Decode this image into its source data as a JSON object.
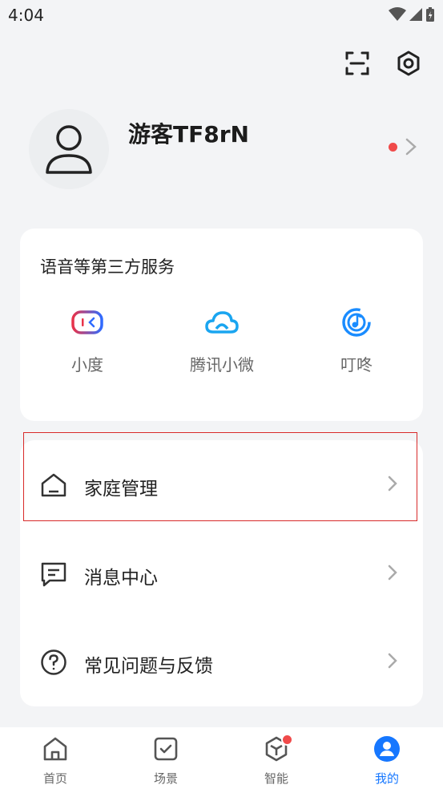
{
  "status_bar": {
    "time": "4:04"
  },
  "profile": {
    "username": "游客TF8rN"
  },
  "voice_services": {
    "title": "语音等第三方服务",
    "items": [
      {
        "label": "小度",
        "icon": "xiaodu-icon"
      },
      {
        "label": "腾讯小微",
        "icon": "tencent-xiaowei-icon"
      },
      {
        "label": "叮咚",
        "icon": "dingdong-icon"
      }
    ]
  },
  "menu": {
    "items": [
      {
        "label": "家庭管理",
        "icon": "home-icon"
      },
      {
        "label": "消息中心",
        "icon": "message-icon"
      },
      {
        "label": "常见问题与反馈",
        "icon": "help-icon"
      }
    ]
  },
  "tabbar": {
    "tabs": [
      {
        "label": "首页",
        "icon": "home-tab-icon"
      },
      {
        "label": "场景",
        "icon": "scene-icon"
      },
      {
        "label": "智能",
        "icon": "smart-icon"
      },
      {
        "label": "我的",
        "icon": "profile-tab-icon"
      }
    ],
    "active_index": 3
  },
  "colors": {
    "accent": "#1677ff",
    "alert": "#f04a4a"
  }
}
